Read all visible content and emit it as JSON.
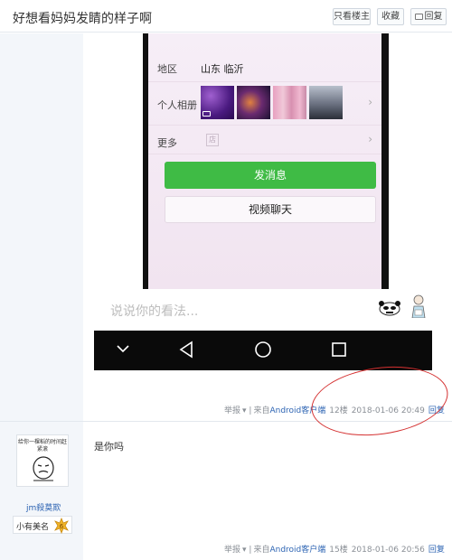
{
  "header": {
    "title": "好想看妈妈发睛的样子啊",
    "btn_only_op": "只看楼主",
    "btn_favorite": "收藏",
    "btn_reply": "回复"
  },
  "screenshot": {
    "region_label": "地区",
    "region_value": "山东 临沂",
    "album_label": "个人相册",
    "more_label": "更多",
    "shop_glyph": "店",
    "chevron": "›",
    "send_button": "发消息",
    "video_button": "视频聊天",
    "comment_placeholder": "说说你的看法..."
  },
  "posts": [
    {
      "report": "举报",
      "source_prefix": "来自",
      "source_link": "Android客户端",
      "floor": "12楼",
      "time": "2018-01-06 20:49",
      "reply": "回复"
    },
    {
      "content": "是你吗",
      "author": "jm殺莫欺",
      "avatar_caption": "给你一棵稻的时间赶紧滚",
      "rank_label": "小有美名",
      "rank_level": "6",
      "report": "举报",
      "source_prefix": "来自",
      "source_link": "Android客户端",
      "floor": "15楼",
      "time": "2018-01-06 20:56",
      "reply": "回复"
    }
  ],
  "colors": {
    "link": "#2d64b3",
    "send_green": "#3fbb45",
    "annotation_red": "#d43030",
    "sidebar_bg": "#f3f6fa"
  },
  "icons": [
    "back-icon",
    "home-icon",
    "recent-apps-icon",
    "panda-sticker-icon",
    "person-sticker-icon",
    "video-icon",
    "shop-icon",
    "chevron-right-icon",
    "reply-icon",
    "rank-badge-icon"
  ]
}
